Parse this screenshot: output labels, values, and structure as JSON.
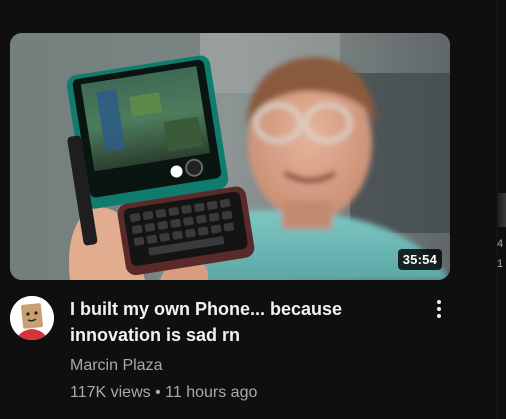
{
  "video": {
    "title": "I built my own Phone... because innovation is sad rn",
    "duration": "35:54",
    "channel": "Marcin Plaza",
    "views": "117K views",
    "separator": "•",
    "age": "11 hours ago"
  },
  "next_card": {
    "meta_line1": "4",
    "meta_line2": "1"
  },
  "icons": {
    "menu": "more-vert-icon",
    "avatar": "channel-avatar"
  }
}
